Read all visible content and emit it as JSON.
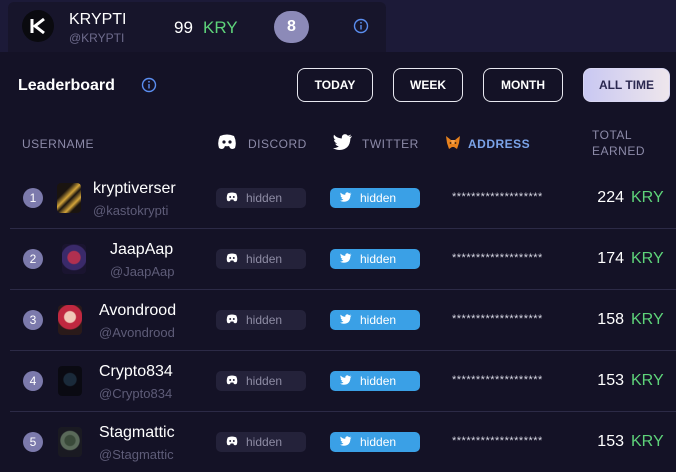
{
  "profile": {
    "name": "KRYPTI",
    "handle": "@KRYPTI",
    "balance_value": "99",
    "balance_currency": "KRY",
    "level": "8"
  },
  "leaderboard": {
    "title": "Leaderboard",
    "filters": [
      {
        "label": "TODAY",
        "active": false
      },
      {
        "label": "WEEK",
        "active": false
      },
      {
        "label": "MONTH",
        "active": false
      },
      {
        "label": "ALL TIME",
        "active": true
      }
    ],
    "columns": {
      "username": "USERNAME",
      "discord": "DISCORD",
      "twitter": "TWITTER",
      "address": "ADDRESS",
      "total_earned_line1": "TOTAL",
      "total_earned_line2": "EARNED"
    },
    "rows": [
      {
        "rank": "1",
        "name": "kryptiverser",
        "handle": "@kastokrypti",
        "discord": "hidden",
        "twitter": "hidden",
        "address": "*******************",
        "earned": "224",
        "currency": "KRY"
      },
      {
        "rank": "2",
        "name": "JaapAap",
        "handle": "@JaapAap",
        "discord": "hidden",
        "twitter": "hidden",
        "address": "*******************",
        "earned": "174",
        "currency": "KRY"
      },
      {
        "rank": "3",
        "name": "Avondrood",
        "handle": "@Avondrood",
        "discord": "hidden",
        "twitter": "hidden",
        "address": "*******************",
        "earned": "158",
        "currency": "KRY"
      },
      {
        "rank": "4",
        "name": "Crypto834",
        "handle": "@Crypto834",
        "discord": "hidden",
        "twitter": "hidden",
        "address": "*******************",
        "earned": "153",
        "currency": "KRY"
      },
      {
        "rank": "5",
        "name": "Stagmattic",
        "handle": "@Stagmattic",
        "discord": "hidden",
        "twitter": "hidden",
        "address": "*******************",
        "earned": "153",
        "currency": "KRY"
      }
    ]
  },
  "colors": {
    "background": "#141226",
    "accent_green": "#5ed37a",
    "twitter_blue": "#3aa0e6",
    "rank_badge": "#7c7aac"
  },
  "icons": {
    "logo": "krypti-k-logo",
    "info": "info-circle-icon",
    "discord": "discord-icon",
    "twitter": "twitter-bird-icon",
    "address": "metamask-fox-icon"
  }
}
